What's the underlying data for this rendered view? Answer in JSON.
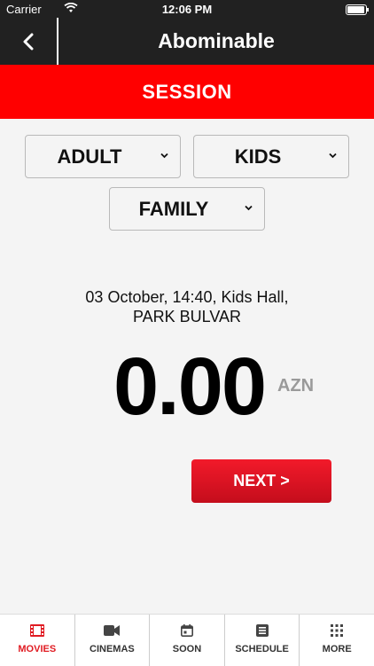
{
  "status_bar": {
    "carrier": "Carrier",
    "time": "12:06 PM"
  },
  "nav": {
    "title": "Abominable",
    "back_icon": "chevron-left-icon"
  },
  "banner": {
    "title": "SESSION"
  },
  "ticket_types": [
    {
      "label": "ADULT"
    },
    {
      "label": "KIDS"
    },
    {
      "label": "FAMILY"
    }
  ],
  "session": {
    "line1": "03 October, 14:40, Kids Hall,",
    "line2": "PARK BULVAR"
  },
  "total": {
    "amount": "0.00",
    "currency": "AZN"
  },
  "next_button": {
    "label": "NEXT >"
  },
  "tabs": [
    {
      "label": "MOVIES",
      "icon": "film-icon",
      "active": true
    },
    {
      "label": "CINEMAS",
      "icon": "video-camera-icon",
      "active": false
    },
    {
      "label": "SOON",
      "icon": "calendar-icon",
      "active": false
    },
    {
      "label": "SCHEDULE",
      "icon": "schedule-list-icon",
      "active": false
    },
    {
      "label": "MORE",
      "icon": "grid-dots-icon",
      "active": false
    }
  ],
  "colors": {
    "accent": "#ff0000",
    "header_bg": "#212121",
    "button": "#e01b22"
  }
}
